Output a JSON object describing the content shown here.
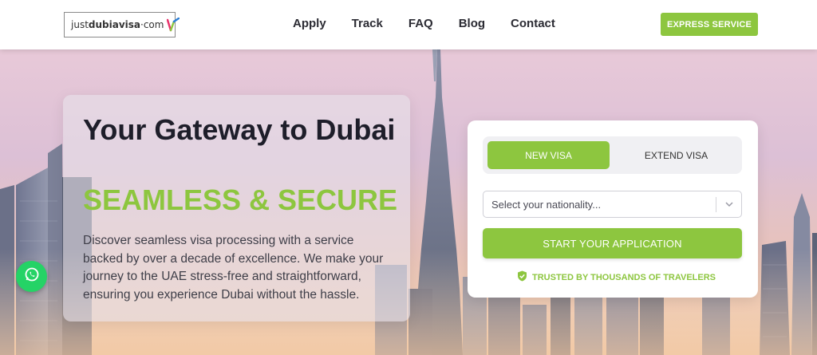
{
  "header": {
    "logo": {
      "prefix": "just",
      "brand": "dubiavisa",
      "suffix": "·com"
    },
    "nav": [
      "Apply",
      "Track",
      "FAQ",
      "Blog",
      "Contact"
    ],
    "express_label": "EXPRESS SERVICE"
  },
  "hero": {
    "title": "Your Gateway to Dubai",
    "subtitle": "SEAMLESS & SECURE",
    "description": "Discover seamless visa processing with a service backed by over a decade of excellence. We make your journey to the UAE stress-free and straightforward, ensuring you experience Dubai without the hassle."
  },
  "form": {
    "tabs": {
      "new": "NEW VISA",
      "extend": "EXTEND VISA"
    },
    "nationality_placeholder": "Select your nationality...",
    "start_label": "START YOUR APPLICATION",
    "trusted_label": "TRUSTED BY THOUSANDS OF TRAVELERS"
  },
  "icons": {
    "whatsapp": "whatsapp-icon",
    "shield": "shield-check-icon",
    "chevron": "chevron-down-icon"
  },
  "colors": {
    "accent": "#8dc63f",
    "dark_text": "#1e1e2a",
    "whatsapp": "#25d366"
  }
}
